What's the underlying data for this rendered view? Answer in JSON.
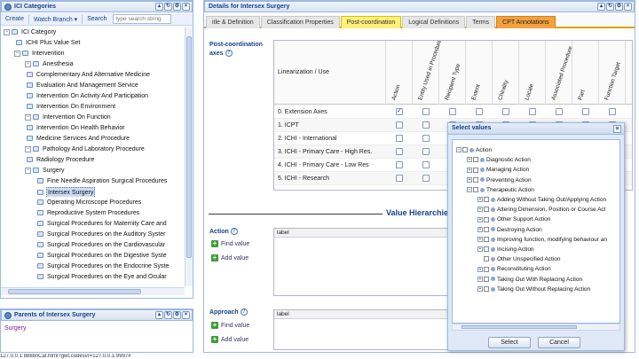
{
  "left_panel": {
    "title": "ICI Categories",
    "toolbar": {
      "create": "Create",
      "watch_branch": "Watch Branch",
      "watch_branch_arrow": "▾",
      "search": "Search",
      "search_placeholder": "type search string"
    },
    "tree": [
      {
        "indent": 0,
        "exp": "−",
        "label": "ICI Category"
      },
      {
        "indent": 1,
        "exp": "",
        "label": "ICHI Plus Value Set"
      },
      {
        "indent": 1,
        "exp": "−",
        "label": "Intervention"
      },
      {
        "indent": 2,
        "exp": "−",
        "label": "Anesthesia"
      },
      {
        "indent": 2,
        "exp": "",
        "label": "Complementary And Alternative Medicine"
      },
      {
        "indent": 2,
        "exp": "",
        "label": "Evaluation And Management Service"
      },
      {
        "indent": 2,
        "exp": "",
        "label": "Intervention On Activity And Participation"
      },
      {
        "indent": 2,
        "exp": "",
        "label": "Intervention On Environment"
      },
      {
        "indent": 2,
        "exp": "−",
        "label": "Intervention On Function"
      },
      {
        "indent": 2,
        "exp": "",
        "label": "Intervention On Health Behavior"
      },
      {
        "indent": 2,
        "exp": "",
        "label": "Medicine Services And Procedure"
      },
      {
        "indent": 2,
        "exp": "−",
        "label": "Pathology And Laboratory Procedure"
      },
      {
        "indent": 2,
        "exp": "",
        "label": "Radiology Procedure"
      },
      {
        "indent": 2,
        "exp": "−",
        "label": "Surgery"
      },
      {
        "indent": 3,
        "exp": "",
        "label": "Fine Needle Aspiration Surgical Procedures"
      },
      {
        "indent": 3,
        "exp": "",
        "label": "Intersex Surgery",
        "selected": true
      },
      {
        "indent": 3,
        "exp": "",
        "label": "Operating Microscope Procedures"
      },
      {
        "indent": 3,
        "exp": "",
        "label": "Reproductive System Procedures"
      },
      {
        "indent": 3,
        "exp": "",
        "label": "Surgical Procedures for Maternity Care and"
      },
      {
        "indent": 3,
        "exp": "",
        "label": "Surgical Procedures on the Auditory Syster"
      },
      {
        "indent": 3,
        "exp": "",
        "label": "Surgical Procedures on the Cardiovascular"
      },
      {
        "indent": 3,
        "exp": "",
        "label": "Surgical Procedures on the Digestive Syste"
      },
      {
        "indent": 3,
        "exp": "",
        "label": "Surgical Procedures on the Endocrine Syste"
      },
      {
        "indent": 3,
        "exp": "",
        "label": "Surgical Procedures on the Eye and Ocular"
      }
    ]
  },
  "parents_panel": {
    "title": "Parents of Intersex Surgery",
    "items": [
      "Surgery"
    ]
  },
  "right_panel": {
    "title": "Details for Intersex Surgery",
    "tabs": [
      {
        "label": "itle & Definition",
        "style": ""
      },
      {
        "label": "Classification Properties",
        "style": ""
      },
      {
        "label": "Post-coordination",
        "style": "active"
      },
      {
        "label": "Logical Definitions",
        "style": ""
      },
      {
        "label": "Terms",
        "style": ""
      },
      {
        "label": "CPT Annotations",
        "style": "special"
      }
    ],
    "pc_label_line1": "Post-coordination",
    "pc_label_line2": "axes",
    "help_glyph": "?",
    "grid": {
      "first_header": "Linearization / Use",
      "columns": [
        "Action",
        "Entity Used in Procedure",
        "Recipient Type",
        "Extent",
        "Chirality",
        "Locale",
        "Associated Procedure",
        "Part",
        "Function Target"
      ],
      "rows": [
        {
          "label": "0. Extension Axes",
          "checked": [
            true,
            false,
            false,
            false,
            false,
            false,
            false,
            false,
            false
          ]
        },
        {
          "label": "1. ICPT",
          "checked": [
            false,
            false,
            false,
            false,
            false,
            false,
            false,
            false,
            false
          ]
        },
        {
          "label": "2. ICHI - International",
          "checked": [
            false,
            false,
            false,
            false,
            false,
            false,
            false,
            false,
            false
          ]
        },
        {
          "label": "3. ICHI - Primary Care - High Res.",
          "checked": [
            false,
            false,
            false,
            false,
            false,
            false,
            false,
            false,
            false
          ]
        },
        {
          "label": "4. ICHI - Primary Care - Low Res",
          "checked": [
            false,
            false,
            false,
            false,
            false,
            false,
            false,
            false,
            false
          ]
        },
        {
          "label": "5. ICHI - Research",
          "checked": [
            false,
            false,
            false,
            false,
            false,
            false,
            false,
            false,
            false
          ]
        }
      ]
    },
    "value_hierarchies_title": "Value Hierarchie",
    "action_section": {
      "label": "Action",
      "find": "Find value",
      "add": "Add value",
      "col_header": "label"
    },
    "approach_section": {
      "label": "Approach",
      "find": "Find value",
      "add": "Add value",
      "col_header": "label"
    }
  },
  "dialog": {
    "title": "Select values",
    "close_glyph": "×",
    "items": [
      {
        "indent": 0,
        "exp": "−",
        "label": "Action"
      },
      {
        "indent": 1,
        "exp": "+",
        "label": "Diagnostic Action"
      },
      {
        "indent": 1,
        "exp": "+",
        "label": "Managing Action"
      },
      {
        "indent": 1,
        "exp": "+",
        "label": "Preventing Action"
      },
      {
        "indent": 1,
        "exp": "−",
        "label": "Therapeutic Action"
      },
      {
        "indent": 2,
        "exp": "+",
        "label": "Adding Without Taking Out/Applying Action"
      },
      {
        "indent": 2,
        "exp": "+",
        "label": "Altering Dimension, Position or Course Act"
      },
      {
        "indent": 2,
        "exp": "+",
        "label": "Other Support Action"
      },
      {
        "indent": 2,
        "exp": "+",
        "label": "Destroying Action"
      },
      {
        "indent": 2,
        "exp": "+",
        "label": "Improving function, modifying behaviour an"
      },
      {
        "indent": 2,
        "exp": "+",
        "label": "Incising Action"
      },
      {
        "indent": 2,
        "exp": "",
        "label": "Other Unspecified Action"
      },
      {
        "indent": 2,
        "exp": "+",
        "label": "Reconstituting Action"
      },
      {
        "indent": 2,
        "exp": "+",
        "label": "Taking Out With Replacing Action"
      },
      {
        "indent": 2,
        "exp": "+",
        "label": "Taking Out Without Replacing Action"
      }
    ],
    "select_label": "Select",
    "cancel_label": "Cancel"
  },
  "status_bar": "127.0.0.1:8888/iCat.html?gwt.codesvr=127.0.0.1:9997#"
}
